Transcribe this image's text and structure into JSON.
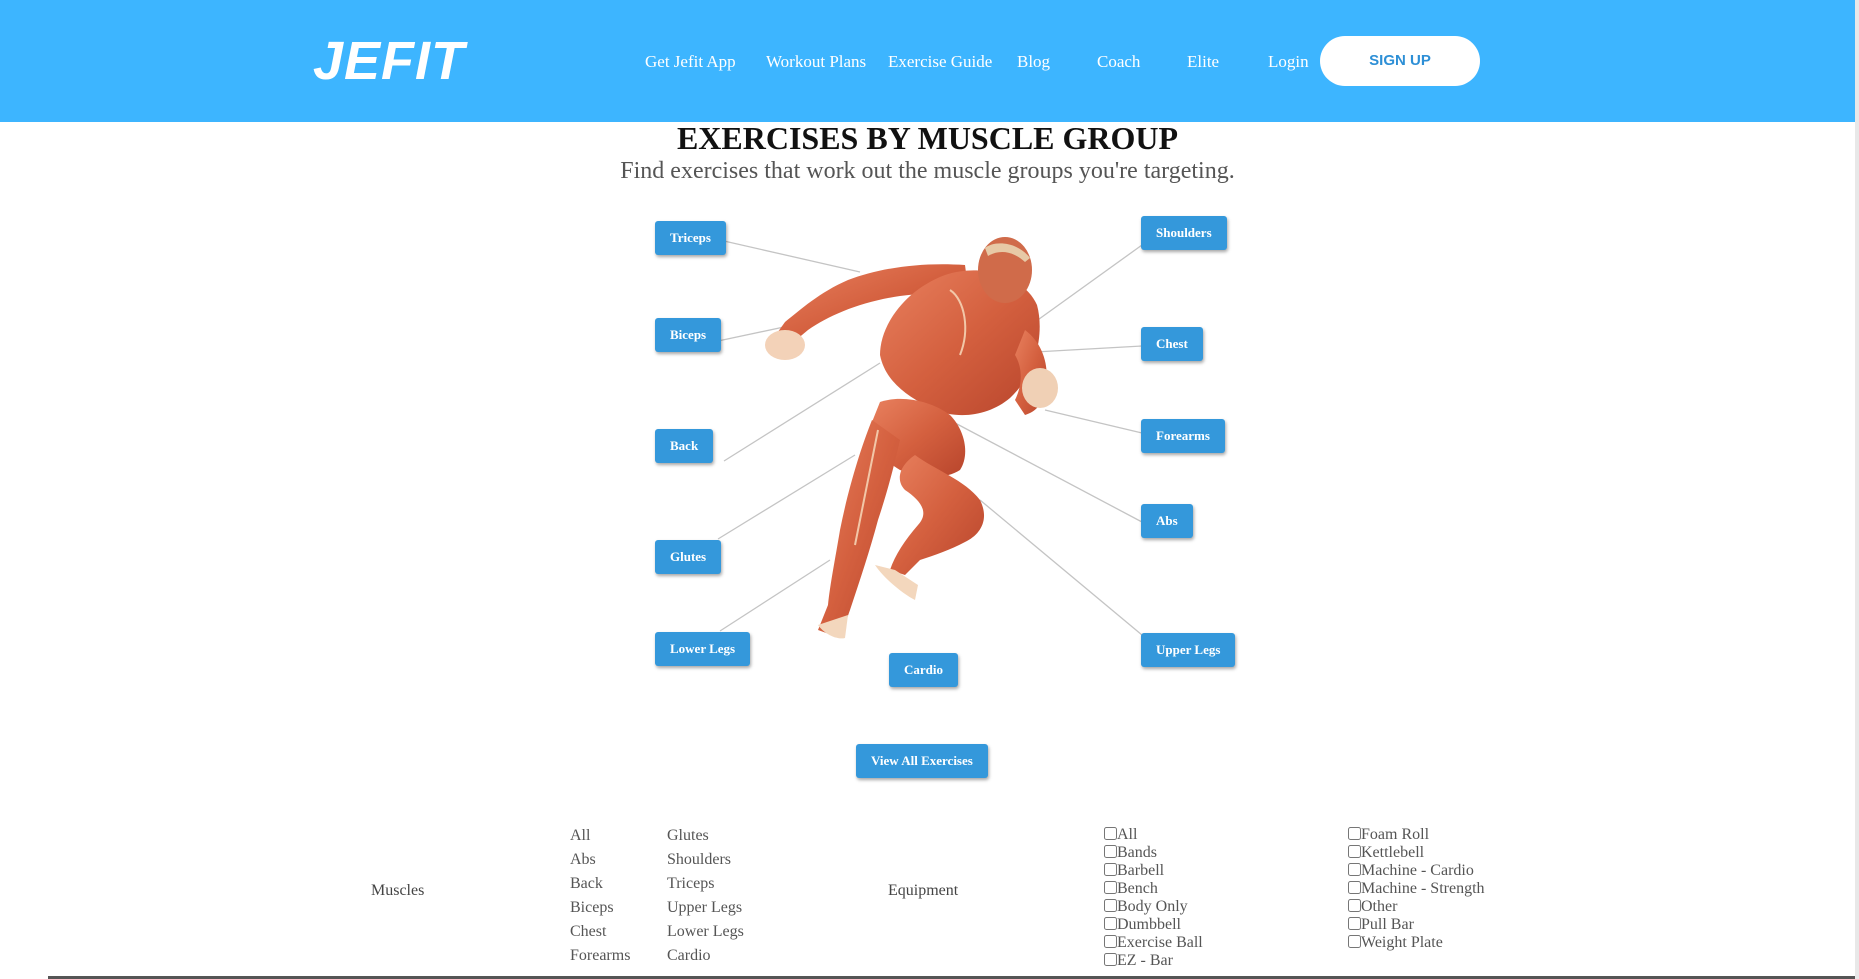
{
  "header": {
    "logo": "JEFIT",
    "nav": [
      "Get Jefit App",
      "Workout Plans",
      "Exercise Guide",
      "Blog",
      "Coach",
      "Elite",
      "Login"
    ],
    "signup_label": "SIGN UP",
    "background_color": "#3db5ff"
  },
  "page": {
    "title": "EXERCISES BY MUSCLE GROUP",
    "subtitle": "Find exercises that work out the muscle groups you're targeting."
  },
  "muscle_buttons": {
    "triceps": "Triceps",
    "biceps": "Biceps",
    "back": "Back",
    "glutes": "Glutes",
    "lower_legs": "Lower Legs",
    "cardio": "Cardio",
    "shoulders": "Shoulders",
    "chest": "Chest",
    "forearms": "Forearms",
    "abs": "Abs",
    "upper_legs": "Upper Legs",
    "button_color": "#3498db"
  },
  "view_all_label": "View All Exercises",
  "filters": {
    "muscles_label": "Muscles",
    "muscles_col1": [
      "All",
      "Abs",
      "Back",
      "Biceps",
      "Chest",
      "Forearms"
    ],
    "muscles_col2": [
      "Glutes",
      "Shoulders",
      "Triceps",
      "Upper Legs",
      "Lower Legs",
      "Cardio"
    ],
    "equipment_label": "Equipment",
    "equipment_col1": [
      "All",
      "Bands",
      "Barbell",
      "Bench",
      "Body Only",
      "Dumbbell",
      "Exercise Ball",
      "EZ - Bar"
    ],
    "equipment_col2": [
      "Foam Roll",
      "Kettlebell",
      "Machine - Cardio",
      "Machine - Strength",
      "Other",
      "Pull Bar",
      "Weight Plate"
    ]
  }
}
